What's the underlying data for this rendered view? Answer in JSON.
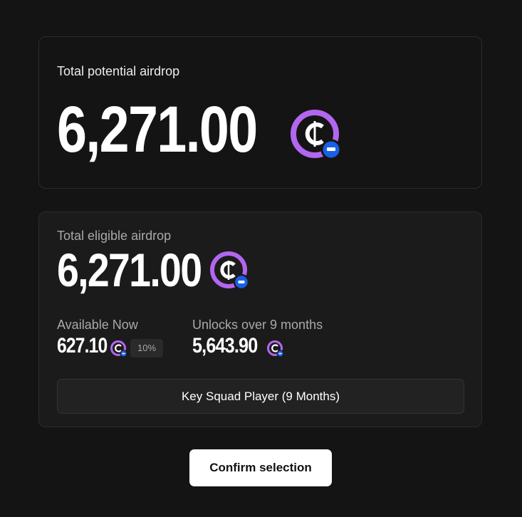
{
  "potential": {
    "label": "Total potential airdrop",
    "amount": "6,271.00",
    "token_icon": "c-coin-icon"
  },
  "eligible": {
    "label": "Total eligible airdrop",
    "amount": "6,271.00",
    "token_icon": "c-coin-icon",
    "available": {
      "label": "Available Now",
      "amount": "627.10",
      "percent": "10%"
    },
    "unlocks": {
      "label": "Unlocks over 9 months",
      "amount": "5,643.90"
    },
    "plan_option": "Key Squad Player (9 Months)"
  },
  "actions": {
    "confirm_label": "Confirm selection"
  },
  "colors": {
    "background": "#141414",
    "card_secondary": "#1b1b1b",
    "coin_ring": "#b366f0",
    "coin_badge": "#1a5fe6",
    "button": "#ffffff"
  }
}
